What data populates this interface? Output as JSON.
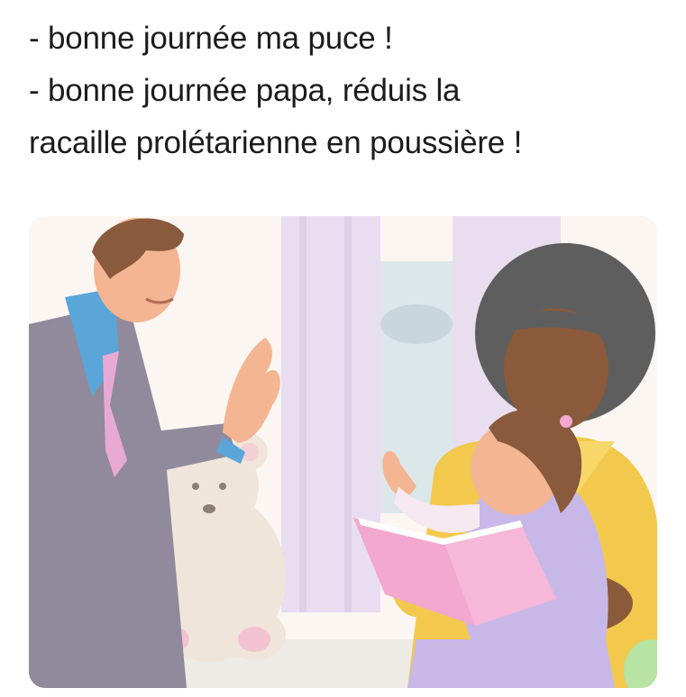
{
  "caption": {
    "lines": [
      "- bonne journée ma puce !",
      "- bonne journée papa, réduis la",
      "racaille prolétarienne en poussière !"
    ]
  },
  "illustration": {
    "description_icon": "family-scene-illustration",
    "colors": {
      "background": "#fbf6f2",
      "curtain": "#e8ddf0",
      "window": "#dbe6ea",
      "suit": "#8e8799",
      "shirt": "#5aa6d8",
      "tie": "#e6a8d3",
      "skin_man": "#f2b38e",
      "hair_man": "#8a5a3c",
      "sweater": "#f2c94c",
      "skin_woman": "#8a5a3a",
      "hair_woman": "#5a5a5a",
      "dress": "#c8b8e8",
      "book": "#f2a8cf",
      "bear": "#efe3d8"
    }
  }
}
